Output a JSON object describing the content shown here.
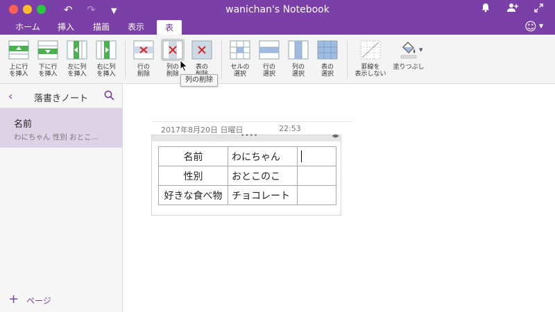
{
  "window": {
    "title": "wanichan's Notebook",
    "icons": {
      "undo": "undo-icon",
      "redo": "redo-icon",
      "more": "caret-down-icon",
      "notifications": "bell-icon",
      "share": "add-person-icon",
      "fullscreen": "expand-icon"
    }
  },
  "tabs": [
    {
      "label": "ホーム",
      "active": false
    },
    {
      "label": "挿入",
      "active": false
    },
    {
      "label": "描画",
      "active": false
    },
    {
      "label": "表示",
      "active": false
    },
    {
      "label": "表",
      "active": true
    }
  ],
  "ribbon": {
    "insert_above": "上に行\nを挿入",
    "insert_below": "下に行\nを挿入",
    "insert_left": "左に列\nを挿入",
    "insert_right": "右に列\nを挿入",
    "delete_rows": "行の\n削除",
    "delete_columns": "列の\n削除",
    "delete_table": "表の\n削除",
    "select_cell": "セルの\n選択",
    "select_rows": "行の\n選択",
    "select_columns": "列の\n選択",
    "select_table": "表の\n選択",
    "hide_borders": "罫線を\n表示しない",
    "shading": "塗りつぶし",
    "tooltip": "列の削除"
  },
  "sidebar": {
    "section_title": "落書きノート",
    "pages": [
      {
        "title": "名前",
        "preview": "わにちゃん  性別  おとこ…",
        "selected": true
      }
    ],
    "add_page": "ページ"
  },
  "page": {
    "date": "2017年8月20日 日曜日",
    "time": "22:53",
    "table": [
      [
        "名前",
        "わにちゃん",
        ""
      ],
      [
        "性別",
        "おとこのこ",
        ""
      ],
      [
        "好きな食べ物",
        "チョコレート",
        ""
      ]
    ]
  },
  "colors": {
    "accent": "#7b3fa8",
    "selected_page": "#ddd3e6",
    "delete_x": "#d03030",
    "insert_green": "#4caf50"
  }
}
